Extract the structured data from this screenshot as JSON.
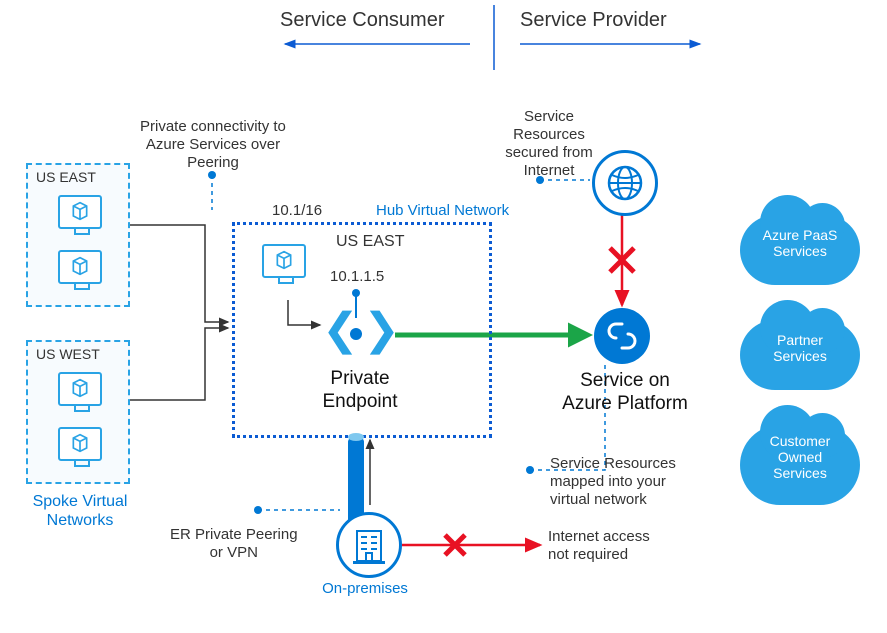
{
  "header": {
    "consumer": "Service Consumer",
    "provider": "Service Provider"
  },
  "spokes": {
    "caption": "Spoke Virtual\nNetworks",
    "regions": [
      "US EAST",
      "US WEST"
    ]
  },
  "annotations": {
    "peering": "Private connectivity to\nAzure Services over\nPeering",
    "er_vpn": "ER Private Peering\nor VPN",
    "secured": "Service\nResources\nsecured from\nInternet",
    "mapped": "Service Resources\nmapped into your\nvirtual network",
    "internet_not_required": "Internet access\nnot required"
  },
  "hub": {
    "title": "Hub Virtual Network",
    "region": "US EAST",
    "cidr": "10.1/16",
    "endpoint_ip": "10.1.1.5",
    "endpoint_label": "Private\nEndpoint"
  },
  "service": {
    "label": "Service on\nAzure Platform"
  },
  "onprem": {
    "label": "On-premises"
  },
  "clouds": {
    "paas": "Azure PaaS\nServices",
    "partner": "Partner\nServices",
    "customer": "Customer\nOwned\nServices"
  }
}
